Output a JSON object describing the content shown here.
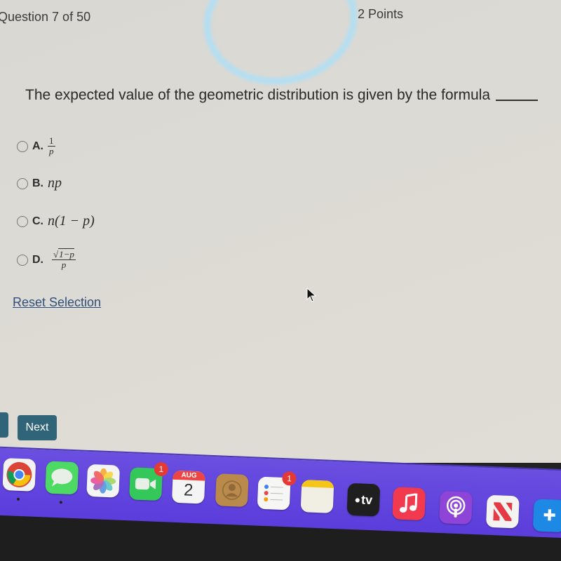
{
  "header": {
    "question_counter": "Question 7 of 50",
    "points": "2 Points"
  },
  "question": {
    "text": "The expected value of the geometric distribution is given by the formula"
  },
  "options": [
    {
      "letter": "A.",
      "expr_num": "1",
      "expr_den": "p",
      "selected": false
    },
    {
      "letter": "B.",
      "expr": "np",
      "selected": false
    },
    {
      "letter": "C.",
      "expr": "n(1 − p)",
      "selected": false
    },
    {
      "letter": "D.",
      "expr_num": "1−p",
      "expr_den": "p",
      "sqrt": "√",
      "selected": false
    }
  ],
  "reset_label": "Reset Selection",
  "nav": {
    "next_label": "Next"
  },
  "dock": {
    "apps": [
      {
        "name": "Chrome",
        "icon": "chrome-icon",
        "running": true
      },
      {
        "name": "Messages",
        "icon": "messages-icon",
        "running": true
      },
      {
        "name": "Photos",
        "icon": "photos-icon"
      },
      {
        "name": "FaceTime",
        "icon": "facetime-icon",
        "badge": "1"
      },
      {
        "name": "Calendar",
        "icon": "calendar-icon",
        "month": "AUG",
        "day": "2"
      },
      {
        "name": "Contacts",
        "icon": "contacts-icon"
      },
      {
        "name": "Reminders",
        "icon": "reminders-icon",
        "badge": "1"
      },
      {
        "name": "Notes",
        "icon": "notes-icon"
      },
      {
        "name": "TV",
        "icon": "apple-tv-icon",
        "label": "tv"
      },
      {
        "name": "Music",
        "icon": "music-icon"
      },
      {
        "name": "Podcasts",
        "icon": "podcasts-icon"
      },
      {
        "name": "News",
        "icon": "news-icon"
      },
      {
        "name": "App Store",
        "icon": "app-store-icon"
      }
    ]
  },
  "colors": {
    "button": "#2f6479",
    "link": "#2d4f7a",
    "dock": "#5b3ddc",
    "badge": "#e53935"
  }
}
